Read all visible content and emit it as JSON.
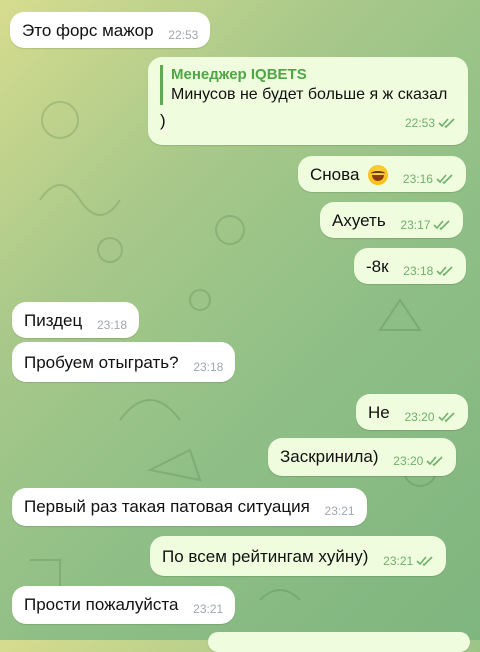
{
  "messages": [
    {
      "id": "m1",
      "dir": "in",
      "text": "Это форс мажор",
      "time": "22:53"
    },
    {
      "id": "m2",
      "dir": "out",
      "reply": {
        "name": "Менеджер IQBETS",
        "text": "Минусов не будет больше я ж сказал"
      },
      "text": ")",
      "time": "22:53"
    },
    {
      "id": "m3",
      "dir": "out",
      "text": "Снова",
      "emoji": "joy-emoji",
      "time": "23:16"
    },
    {
      "id": "m4",
      "dir": "out",
      "text": "Ахуеть",
      "time": "23:17"
    },
    {
      "id": "m5",
      "dir": "out",
      "text": "-8к",
      "time": "23:18"
    },
    {
      "id": "m6",
      "dir": "in",
      "text": "Пиздец",
      "time": "23:18"
    },
    {
      "id": "m7",
      "dir": "in",
      "text": "Пробуем отыграть?",
      "time": "23:18"
    },
    {
      "id": "m8",
      "dir": "out",
      "text": "Не",
      "time": "23:20"
    },
    {
      "id": "m9",
      "dir": "out",
      "text": "Заскринила)",
      "time": "23:20"
    },
    {
      "id": "m10",
      "dir": "in",
      "text": "Первый раз такая патовая ситуация",
      "time": "23:21"
    },
    {
      "id": "m11",
      "dir": "out",
      "text": "По всем рейтингам хуйну)",
      "time": "23:21"
    },
    {
      "id": "m12",
      "dir": "in",
      "text": "Прости пожалуйста",
      "time": "23:21"
    }
  ],
  "colors": {
    "incoming": "#ffffff",
    "outgoing": "#effdde",
    "accent": "#4fa645"
  }
}
